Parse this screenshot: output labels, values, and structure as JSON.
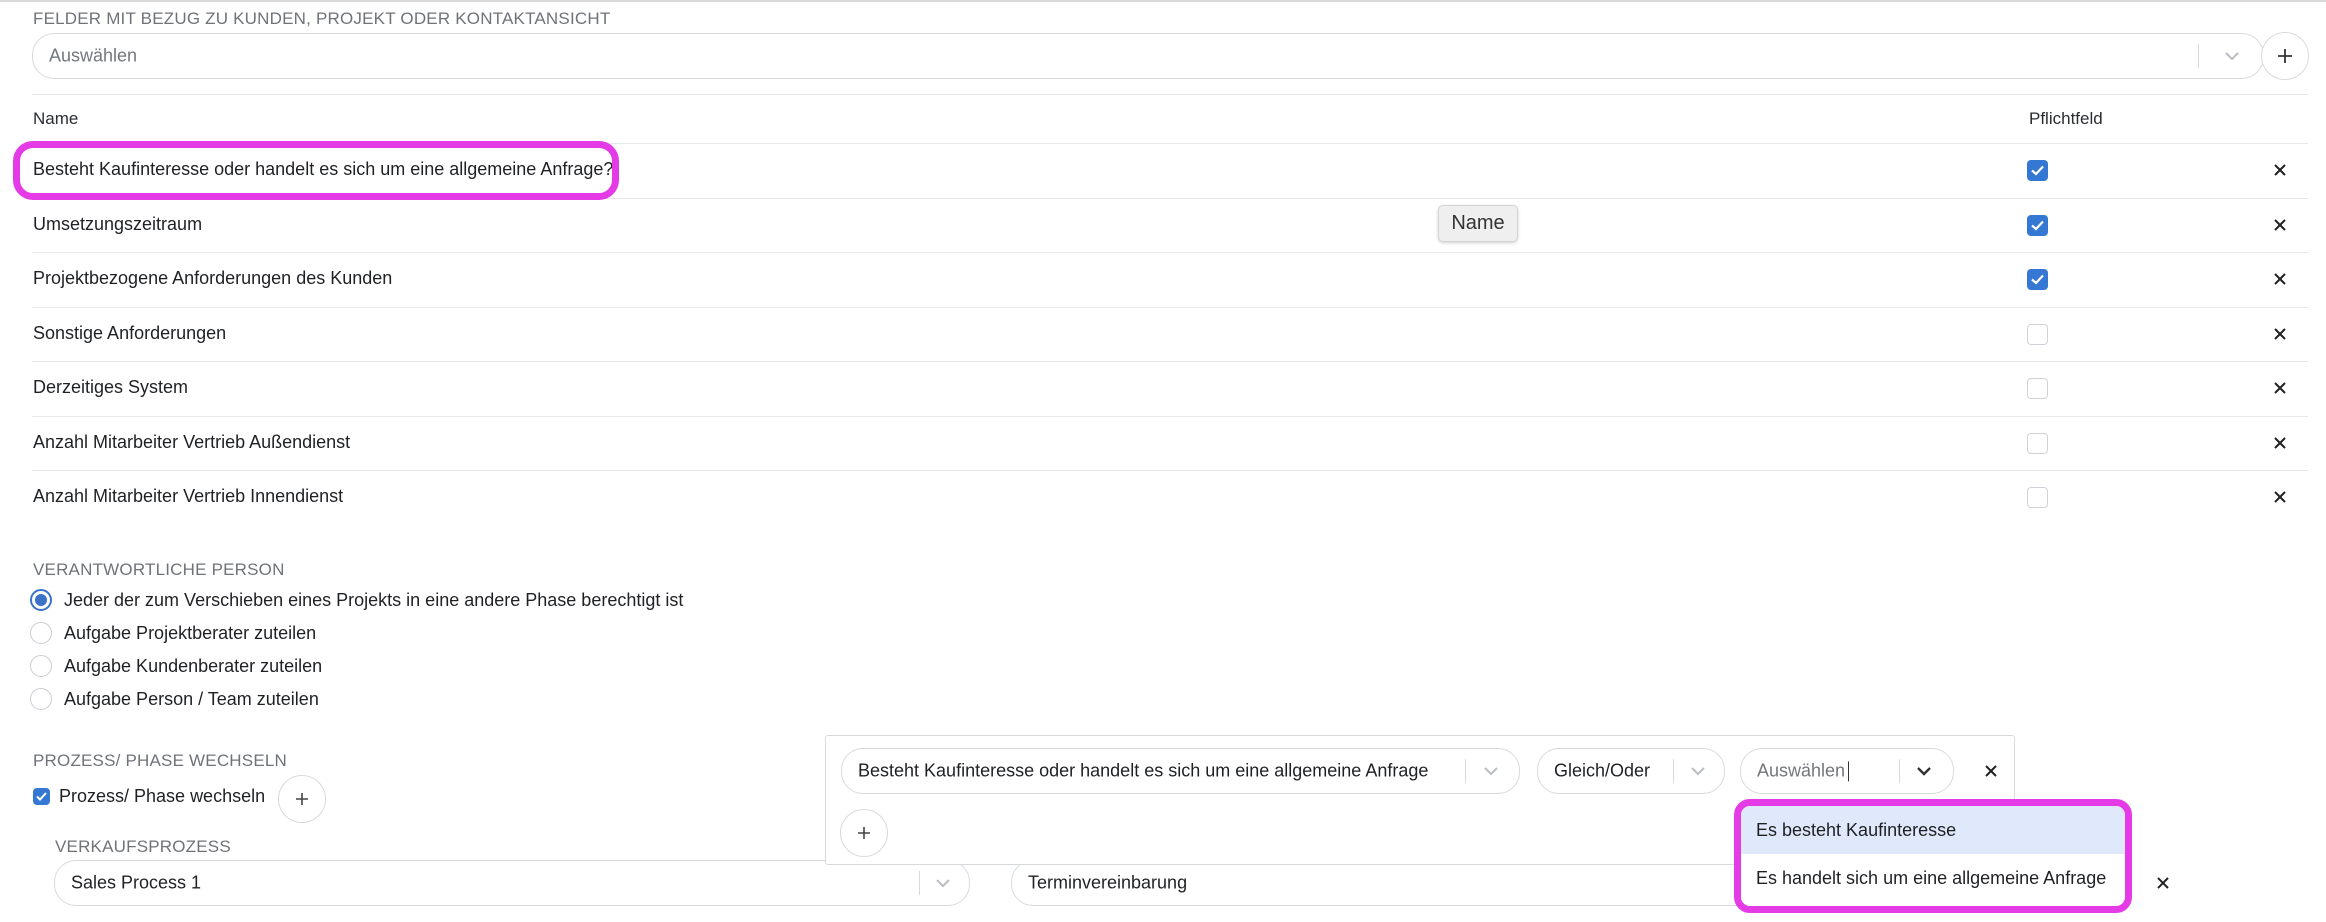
{
  "fields_section": {
    "label": "FELDER MIT BEZUG ZU KUNDEN, PROJEKT ODER KONTAKTANSICHT",
    "select_placeholder": "Auswählen"
  },
  "table": {
    "col_name": "Name",
    "col_required": "Pflichtfeld",
    "rows": [
      {
        "name": "Besteht Kaufinteresse oder handelt es sich um eine allgemeine Anfrage?",
        "required": true
      },
      {
        "name": "Umsetzungszeitraum",
        "required": true
      },
      {
        "name": "Projektbezogene Anforderungen des Kunden",
        "required": true
      },
      {
        "name": "Sonstige Anforderungen",
        "required": false
      },
      {
        "name": "Derzeitiges System",
        "required": false
      },
      {
        "name": "Anzahl Mitarbeiter Vertrieb Außendienst",
        "required": false
      },
      {
        "name": "Anzahl Mitarbeiter Vertrieb Innendienst",
        "required": false
      }
    ]
  },
  "tooltip": "Name",
  "responsible": {
    "label": "VERANTWORTLICHE PERSON",
    "options": [
      {
        "label": "Jeder der zum Verschieben eines Projekts in eine andere Phase berechtigt ist",
        "selected": true
      },
      {
        "label": "Aufgabe Projektberater zuteilen",
        "selected": false
      },
      {
        "label": "Aufgabe Kundenberater zuteilen",
        "selected": false
      },
      {
        "label": "Aufgabe Person / Team zuteilen",
        "selected": false
      }
    ]
  },
  "process": {
    "label": "PROZESS/ PHASE WECHSELN",
    "checkbox_label": "Prozess/ Phase wechseln",
    "checked": true,
    "sales_label": "VERKAUFSPROZESS",
    "sales_value": "Sales Process 1",
    "phase_value": "Terminvereinbarung"
  },
  "condition": {
    "field_value": "Besteht Kaufinteresse oder handelt es sich um eine allgemeine Anfrage",
    "operator_value": "Gleich/Oder",
    "value_placeholder": "Auswählen"
  },
  "dropdown": {
    "options": [
      {
        "label": "Es besteht Kaufinteresse",
        "active": true
      },
      {
        "label": "Es handelt sich um eine allgemeine Anfrage",
        "active": false
      }
    ]
  },
  "colors": {
    "accent": "#3478d4",
    "highlight": "#e53be7"
  }
}
